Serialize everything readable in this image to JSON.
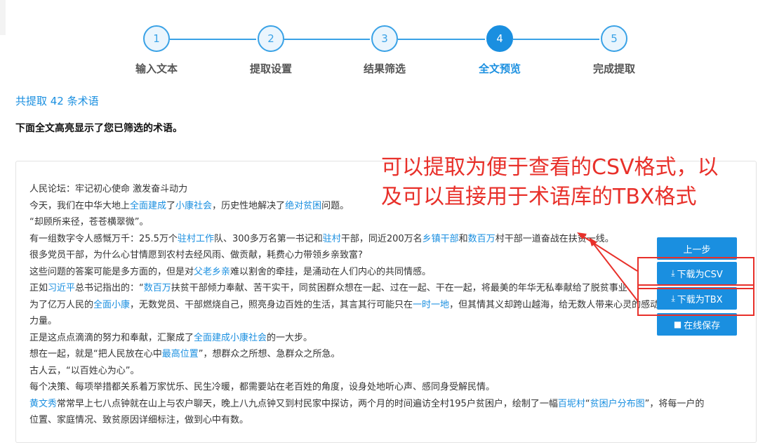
{
  "steps": [
    {
      "num": "1",
      "label": "输入文本"
    },
    {
      "num": "2",
      "label": "提取设置"
    },
    {
      "num": "3",
      "label": "结果筛选"
    },
    {
      "num": "4",
      "label": "全文预览",
      "active": true
    },
    {
      "num": "5",
      "label": "完成提取"
    }
  ],
  "summary": "共提取 42 条术语",
  "description": "下面全文高亮显示了您已筛选的术语。",
  "text_lines": [
    [
      {
        "t": "人民论坛：牢记初心使命 激发奋斗动力"
      }
    ],
    [
      {
        "t": "今天，我们在中华大地上"
      },
      {
        "t": "全面建成",
        "h": true
      },
      {
        "t": "了"
      },
      {
        "t": "小康社会",
        "h": true
      },
      {
        "t": "，历史性地解决了"
      },
      {
        "t": "绝对贫困",
        "h": true
      },
      {
        "t": "问题。"
      }
    ],
    [
      {
        "t": "“却顾所来径，苍苍横翠微”。"
      }
    ],
    [
      {
        "t": "有一组数字令人感慨万千：25.5万个"
      },
      {
        "t": "驻村工作",
        "h": true
      },
      {
        "t": "队、300多万名第一书记和"
      },
      {
        "t": "驻村",
        "h": true
      },
      {
        "t": "干部，同近200万名"
      },
      {
        "t": "乡镇干部",
        "h": true
      },
      {
        "t": "和"
      },
      {
        "t": "数百万",
        "h": true
      },
      {
        "t": "村干部一道奋战在扶贫一线。"
      }
    ],
    [
      {
        "t": "很多党员干部，为什么心甘情愿到农村去经风雨、做贡献，耗费心力带领乡亲致富?"
      }
    ],
    [
      {
        "t": "这些问题的答案可能是多方面的，但是对"
      },
      {
        "t": "父老乡亲",
        "h": true
      },
      {
        "t": "难以割舍的牵挂，是涌动在人们内心的共同情感。"
      }
    ],
    [
      {
        "t": "正如"
      },
      {
        "t": "习近平",
        "h": true
      },
      {
        "t": "总书记指出的：“"
      },
      {
        "t": "数百万",
        "h": true
      },
      {
        "t": "扶贫干部倾力奉献、苦干实干，同贫困群众想在一起、过在一起、干在一起，将最美的年华无私奉献给了脱贫事业"
      }
    ],
    [
      {
        "t": "为了亿万人民的"
      },
      {
        "t": "全面小康",
        "h": true
      },
      {
        "t": "，无数党员、干部燃烧自己，照亮身边百姓的生活，其言其行可能只在"
      },
      {
        "t": "一时一地",
        "h": true
      },
      {
        "t": "，但其情其义却跨山越海，给无数人带来心灵的感动和前行"
      }
    ],
    [
      {
        "t": "力量。"
      }
    ],
    [
      {
        "t": "正是这点点滴滴的努力和奉献，汇聚成了"
      },
      {
        "t": "全面建成小康社会",
        "h": true
      },
      {
        "t": "的一大步。"
      }
    ],
    [
      {
        "t": "想在一起，就是“把人民放在心中"
      },
      {
        "t": "最高位置",
        "h": true
      },
      {
        "t": "”，想群众之所想、急群众之所急。"
      }
    ],
    [
      {
        "t": "古人云，“以百姓心为心”。"
      }
    ],
    [
      {
        "t": "每个决策、每项举措都关系着万家忧乐、民生冷暖，都需要站在老百姓的角度，设身处地听心声、感同身受解民情。"
      }
    ],
    [
      {
        "t": "黄文秀",
        "h": true
      },
      {
        "t": "常常早上七八点钟就在山上与农户聊天，晚上八九点钟又到村民家中探访，两个月的时间遍访全村195户贫困户，绘制了一幅"
      },
      {
        "t": "百坭村",
        "h": true
      },
      {
        "t": "“"
      },
      {
        "t": "贫困户分布图",
        "h": true
      },
      {
        "t": "”，将每一户的"
      }
    ],
    [
      {
        "t": "位置、家庭情况、致贫原因详细标注，做到心中有数。"
      }
    ]
  ],
  "buttons": {
    "prev": "上一步",
    "csv": "下载为CSV",
    "tbx": "下载为TBX",
    "save": "在线保存"
  },
  "annotation": {
    "line1": "可以提取为便于查看的CSV格式，以",
    "line2": "及可以直接用于术语库的TBX格式"
  },
  "colors": {
    "accent": "#1a8fe0",
    "annotation": "#e8302a"
  }
}
